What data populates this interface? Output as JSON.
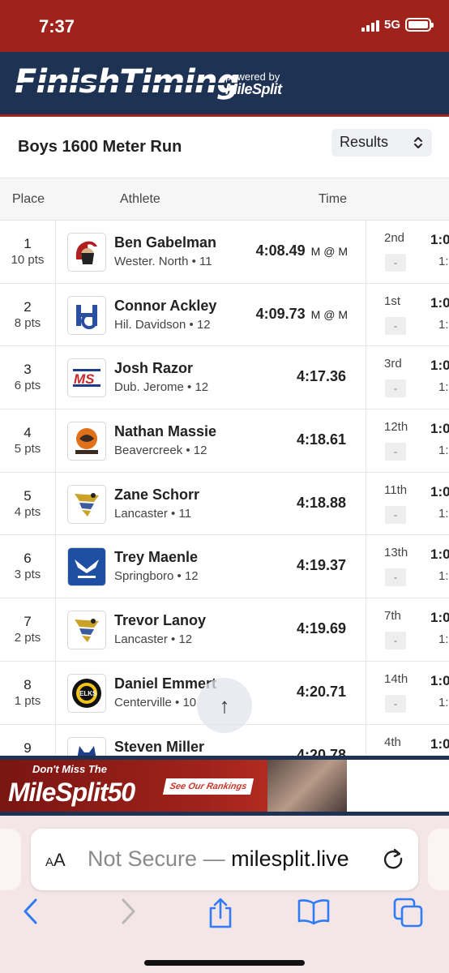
{
  "status": {
    "time": "7:37",
    "network": "5G"
  },
  "brand": {
    "logo_text": "FinishTiming",
    "powered_by": "powered by",
    "partner": "MileSplit"
  },
  "event": {
    "title": "Boys 1600 Meter Run",
    "view": "Results"
  },
  "table": {
    "headers": {
      "place": "Place",
      "athlete": "Athlete",
      "time": "Time"
    },
    "rows": [
      {
        "place": "1",
        "pts": "10 pts",
        "name": "Ben Gabelman",
        "team": "Wester. North • 11",
        "time": "4:08.49",
        "qual": "M @ M",
        "split_rank": "2nd",
        "split_box": "-",
        "split_main": "1:0",
        "split_sub": "1:",
        "logo": "spartan-logo"
      },
      {
        "place": "2",
        "pts": "8 pts",
        "name": "Connor Ackley",
        "team": "Hil. Davidson • 12",
        "time": "4:09.73",
        "qual": "M @ M",
        "split_rank": "1st",
        "split_box": "-",
        "split_main": "1:0",
        "split_sub": "1:",
        "logo": "hd-logo"
      },
      {
        "place": "3",
        "pts": "6 pts",
        "name": "Josh Razor",
        "team": "Dub. Jerome • 12",
        "time": "4:17.36",
        "qual": "",
        "split_rank": "3rd",
        "split_box": "-",
        "split_main": "1:0",
        "split_sub": "1:",
        "logo": "ms-logo"
      },
      {
        "place": "4",
        "pts": "5 pts",
        "name": "Nathan Massie",
        "team": "Beavercreek • 12",
        "time": "4:18.61",
        "qual": "",
        "split_rank": "12th",
        "split_box": "-",
        "split_main": "1:0",
        "split_sub": "1:",
        "logo": "beaver-logo"
      },
      {
        "place": "5",
        "pts": "4 pts",
        "name": "Zane Schorr",
        "team": "Lancaster • 11",
        "time": "4:18.88",
        "qual": "",
        "split_rank": "11th",
        "split_box": "-",
        "split_main": "1:0",
        "split_sub": "1:",
        "logo": "tornado-logo"
      },
      {
        "place": "6",
        "pts": "3 pts",
        "name": "Trey Maenle",
        "team": "Springboro • 12",
        "time": "4:19.37",
        "qual": "",
        "split_rank": "13th",
        "split_box": "-",
        "split_main": "1:0",
        "split_sub": "1:",
        "logo": "panthers-logo"
      },
      {
        "place": "7",
        "pts": "2 pts",
        "name": "Trevor Lanoy",
        "team": "Lancaster • 12",
        "time": "4:19.69",
        "qual": "",
        "split_rank": "7th",
        "split_box": "-",
        "split_main": "1:0",
        "split_sub": "1:",
        "logo": "tornado-logo"
      },
      {
        "place": "8",
        "pts": "1 pts",
        "name": "Daniel Emmert",
        "team": "Centerville • 10",
        "time": "4:20.71",
        "qual": "",
        "split_rank": "14th",
        "split_box": "-",
        "split_main": "1:0",
        "split_sub": "1:",
        "logo": "elks-logo"
      },
      {
        "place": "9",
        "pts": "",
        "name": "Steven Miller",
        "team": "",
        "time": "4:20.78",
        "qual": "",
        "split_rank": "4th",
        "split_box": "-",
        "split_main": "1:0",
        "split_sub": "",
        "logo": "husky-logo"
      }
    ]
  },
  "ad": {
    "small": "Don't Miss The",
    "big": "MileSplit50",
    "link": "See Our Rankings"
  },
  "browser": {
    "aa": "AA",
    "url_prefix": "Not Secure — ",
    "url_host": "milesplit.live"
  },
  "colors": {
    "status_bar": "#a0231b",
    "brand_bar": "#1e3354",
    "browser_bg": "#f4e6e6",
    "ios_blue": "#2f7cf6"
  },
  "icons": {
    "scroll_top": "arrow-up-icon",
    "reload": "reload-icon",
    "back": "chevron-left-icon",
    "forward": "chevron-right-icon",
    "share": "share-icon",
    "bookmarks": "book-icon",
    "tabs": "tabs-icon"
  }
}
